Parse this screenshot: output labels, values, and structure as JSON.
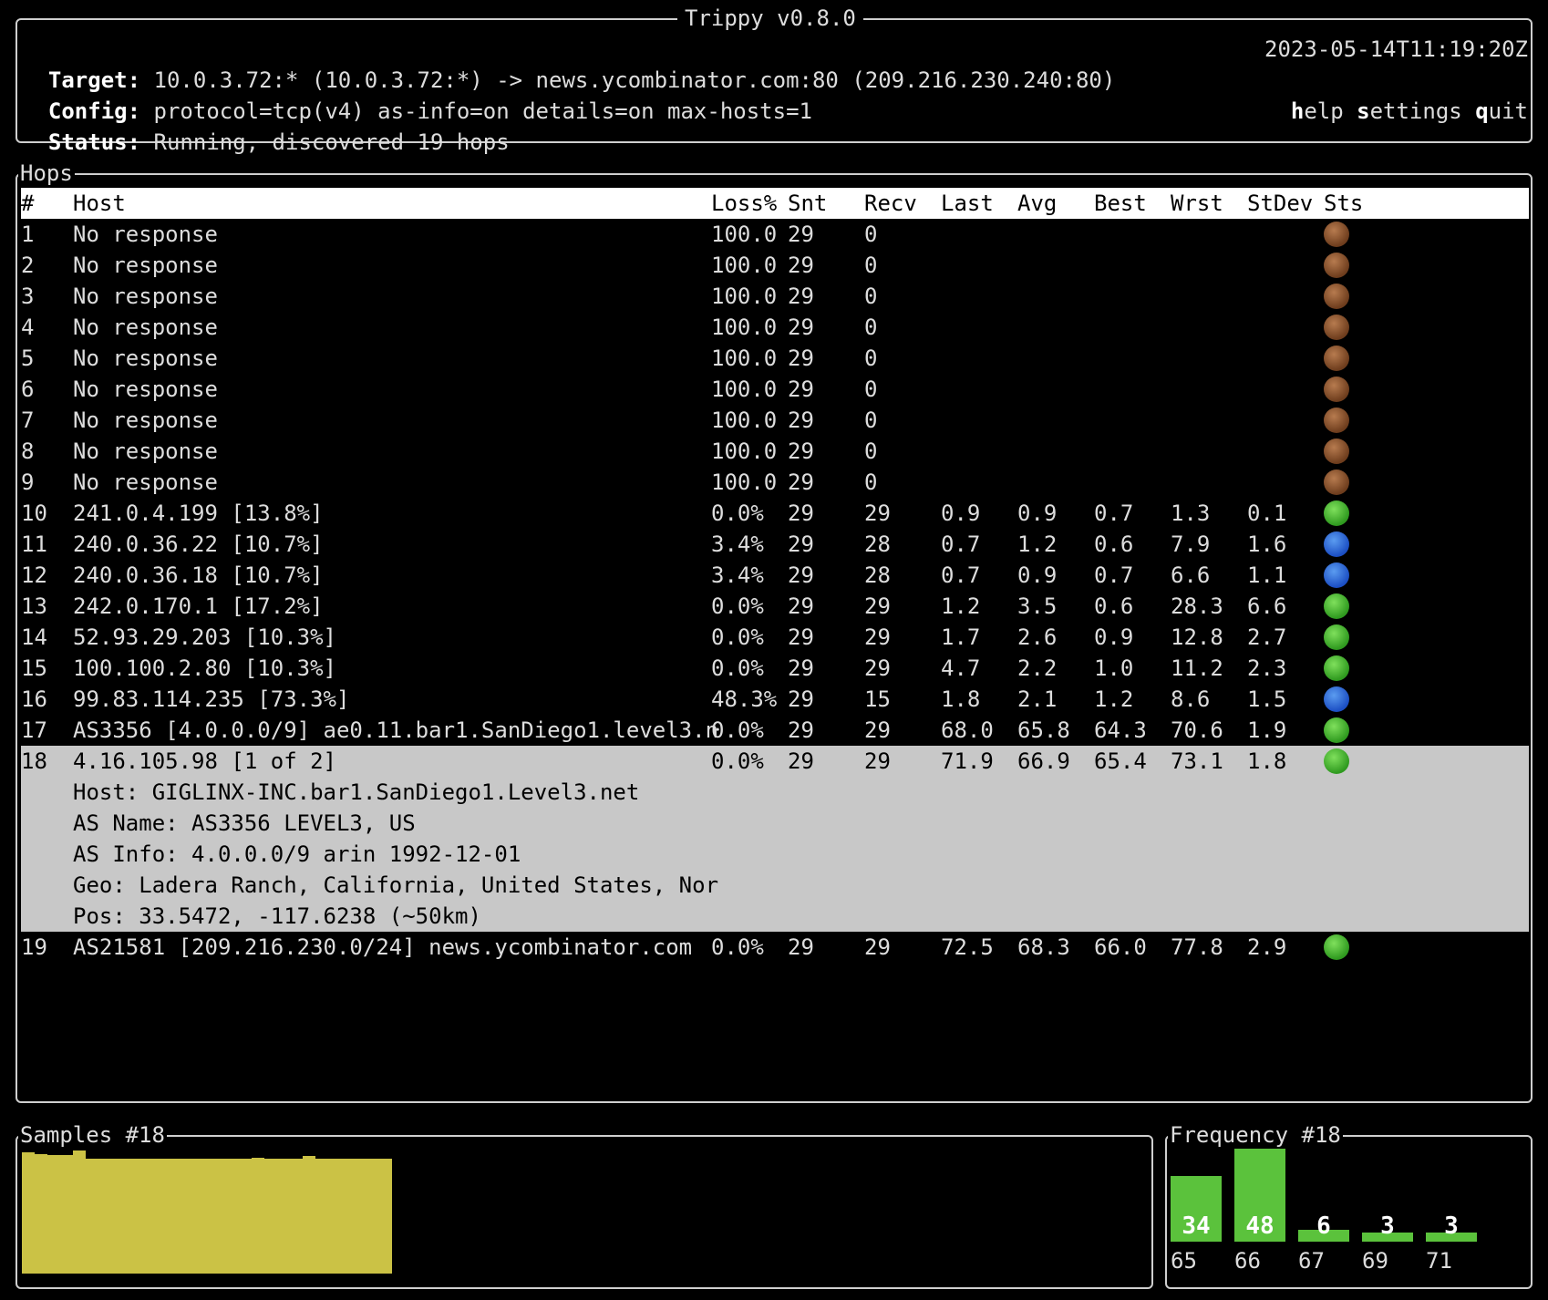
{
  "app": {
    "title": "Trippy v0.8.0"
  },
  "header": {
    "target_label": "Target:",
    "target_value": "10.0.3.72:* (10.0.3.72:*) -> news.ycombinator.com:80 (209.216.230.240:80)",
    "config_label": "Config:",
    "config_value": "protocol=tcp(v4) as-info=on details=on max-hosts=1",
    "status_label": "Status:",
    "status_value": "Running, discovered 19 hops",
    "timestamp": "2023-05-14T11:19:20Z",
    "menu": [
      {
        "key": "h",
        "rest": "elp"
      },
      {
        "key": "s",
        "rest": "ettings"
      },
      {
        "key": "q",
        "rest": "uit"
      }
    ]
  },
  "hops": {
    "title": "Hops",
    "columns": [
      "#",
      "Host",
      "Loss%",
      "Snt",
      "Recv",
      "Last",
      "Avg",
      "Best",
      "Wrst",
      "StDev",
      "Sts"
    ],
    "rows": [
      {
        "n": "1",
        "host": "No response",
        "loss": "100.0",
        "snt": "29",
        "recv": "0",
        "last": "",
        "avg": "",
        "best": "",
        "wrst": "",
        "stdev": "",
        "sts": "brown"
      },
      {
        "n": "2",
        "host": "No response",
        "loss": "100.0",
        "snt": "29",
        "recv": "0",
        "last": "",
        "avg": "",
        "best": "",
        "wrst": "",
        "stdev": "",
        "sts": "brown"
      },
      {
        "n": "3",
        "host": "No response",
        "loss": "100.0",
        "snt": "29",
        "recv": "0",
        "last": "",
        "avg": "",
        "best": "",
        "wrst": "",
        "stdev": "",
        "sts": "brown"
      },
      {
        "n": "4",
        "host": "No response",
        "loss": "100.0",
        "snt": "29",
        "recv": "0",
        "last": "",
        "avg": "",
        "best": "",
        "wrst": "",
        "stdev": "",
        "sts": "brown"
      },
      {
        "n": "5",
        "host": "No response",
        "loss": "100.0",
        "snt": "29",
        "recv": "0",
        "last": "",
        "avg": "",
        "best": "",
        "wrst": "",
        "stdev": "",
        "sts": "brown"
      },
      {
        "n": "6",
        "host": "No response",
        "loss": "100.0",
        "snt": "29",
        "recv": "0",
        "last": "",
        "avg": "",
        "best": "",
        "wrst": "",
        "stdev": "",
        "sts": "brown"
      },
      {
        "n": "7",
        "host": "No response",
        "loss": "100.0",
        "snt": "29",
        "recv": "0",
        "last": "",
        "avg": "",
        "best": "",
        "wrst": "",
        "stdev": "",
        "sts": "brown"
      },
      {
        "n": "8",
        "host": "No response",
        "loss": "100.0",
        "snt": "29",
        "recv": "0",
        "last": "",
        "avg": "",
        "best": "",
        "wrst": "",
        "stdev": "",
        "sts": "brown"
      },
      {
        "n": "9",
        "host": "No response",
        "loss": "100.0",
        "snt": "29",
        "recv": "0",
        "last": "",
        "avg": "",
        "best": "",
        "wrst": "",
        "stdev": "",
        "sts": "brown"
      },
      {
        "n": "10",
        "host": "241.0.4.199 [13.8%]",
        "loss": "0.0%",
        "snt": "29",
        "recv": "29",
        "last": "0.9",
        "avg": "0.9",
        "best": "0.7",
        "wrst": "1.3",
        "stdev": "0.1",
        "sts": "green"
      },
      {
        "n": "11",
        "host": "240.0.36.22 [10.7%]",
        "loss": "3.4%",
        "snt": "29",
        "recv": "28",
        "last": "0.7",
        "avg": "1.2",
        "best": "0.6",
        "wrst": "7.9",
        "stdev": "1.6",
        "sts": "blue"
      },
      {
        "n": "12",
        "host": "240.0.36.18 [10.7%]",
        "loss": "3.4%",
        "snt": "29",
        "recv": "28",
        "last": "0.7",
        "avg": "0.9",
        "best": "0.7",
        "wrst": "6.6",
        "stdev": "1.1",
        "sts": "blue"
      },
      {
        "n": "13",
        "host": "242.0.170.1 [17.2%]",
        "loss": "0.0%",
        "snt": "29",
        "recv": "29",
        "last": "1.2",
        "avg": "3.5",
        "best": "0.6",
        "wrst": "28.3",
        "stdev": "6.6",
        "sts": "green"
      },
      {
        "n": "14",
        "host": "52.93.29.203 [10.3%]",
        "loss": "0.0%",
        "snt": "29",
        "recv": "29",
        "last": "1.7",
        "avg": "2.6",
        "best": "0.9",
        "wrst": "12.8",
        "stdev": "2.7",
        "sts": "green"
      },
      {
        "n": "15",
        "host": "100.100.2.80 [10.3%]",
        "loss": "0.0%",
        "snt": "29",
        "recv": "29",
        "last": "4.7",
        "avg": "2.2",
        "best": "1.0",
        "wrst": "11.2",
        "stdev": "2.3",
        "sts": "green"
      },
      {
        "n": "16",
        "host": "99.83.114.235 [73.3%]",
        "loss": "48.3%",
        "snt": "29",
        "recv": "15",
        "last": "1.8",
        "avg": "2.1",
        "best": "1.2",
        "wrst": "8.6",
        "stdev": "1.5",
        "sts": "blue"
      },
      {
        "n": "17",
        "host": "AS3356 [4.0.0.0/9] ae0.11.bar1.SanDiego1.level3.n",
        "loss": "0.0%",
        "snt": "29",
        "recv": "29",
        "last": "68.0",
        "avg": "65.8",
        "best": "64.3",
        "wrst": "70.6",
        "stdev": "1.9",
        "sts": "green"
      },
      {
        "n": "18",
        "host": "4.16.105.98 [1 of 2]",
        "loss": "0.0%",
        "snt": "29",
        "recv": "29",
        "last": "71.9",
        "avg": "66.9",
        "best": "65.4",
        "wrst": "73.1",
        "stdev": "1.8",
        "sts": "green"
      },
      {
        "n": "19",
        "host": "AS21581 [209.216.230.0/24] news.ycombinator.com",
        "loss": "0.0%",
        "snt": "29",
        "recv": "29",
        "last": "72.5",
        "avg": "68.3",
        "best": "66.0",
        "wrst": "77.8",
        "stdev": "2.9",
        "sts": "green"
      }
    ],
    "selected_details": [
      "Host: GIGLINX-INC.bar1.SanDiego1.Level3.net",
      "AS Name: AS3356 LEVEL3, US",
      "AS Info: 4.0.0.0/9 arin 1992-12-01",
      "Geo: Ladera Ranch, California, United States, Nor",
      "Pos: 33.5472, -117.6238 (~50km)"
    ]
  },
  "samples": {
    "title": "Samples #18",
    "color": "#cbc245"
  },
  "frequency": {
    "title": "Frequency #18",
    "color": "#5bc23c"
  },
  "chart_data": [
    {
      "type": "bar",
      "title": "Samples #18",
      "values": [
        71.9,
        70.8,
        70.3,
        70.3,
        73.1,
        68.0,
        68.0,
        68.0,
        68.0,
        68.0,
        68.0,
        68.0,
        68.0,
        68.0,
        68.0,
        68.0,
        68.0,
        68.0,
        68.8,
        68.0,
        68.0,
        68.0,
        70.0,
        68.0,
        68.0,
        68.0,
        68.0,
        68.0,
        68.0
      ],
      "ylim": [
        0,
        73.1
      ]
    },
    {
      "type": "bar",
      "title": "Frequency #18",
      "categories": [
        "65",
        "66",
        "67",
        "69",
        "71"
      ],
      "values": [
        34,
        48,
        6,
        3,
        3
      ]
    }
  ]
}
